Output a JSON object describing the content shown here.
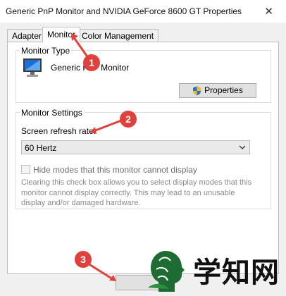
{
  "window": {
    "title": "Generic PnP Monitor and NVIDIA GeForce 8600 GT Properties",
    "close_glyph": "✕"
  },
  "tabs": [
    {
      "label": "Adapter",
      "active": false
    },
    {
      "label": "Monitor",
      "active": true
    },
    {
      "label": "Color Management",
      "active": false
    }
  ],
  "monitor_type": {
    "group_label": "Monitor Type",
    "monitor_name": "Generic PnP Monitor",
    "properties_label": "Properties"
  },
  "monitor_settings": {
    "group_label": "Monitor Settings",
    "refresh_label": "Screen refresh rate:",
    "refresh_value": "60 Hertz",
    "hide_modes_label": "Hide modes that this monitor cannot display",
    "hide_modes_checked": false,
    "description": "Clearing this check box allows you to select display modes that this monitor cannot display correctly. This may lead to an unusable display and/or damaged hardware."
  },
  "bottom_button": {
    "label": ""
  },
  "annotations": [
    {
      "number": "1"
    },
    {
      "number": "2"
    },
    {
      "number": "3"
    }
  ],
  "watermark": {
    "text": "学知网"
  },
  "colors": {
    "callout": "#e0413c",
    "dialog_bg": "#f0f0f0",
    "panel_bg": "#ffffff"
  }
}
